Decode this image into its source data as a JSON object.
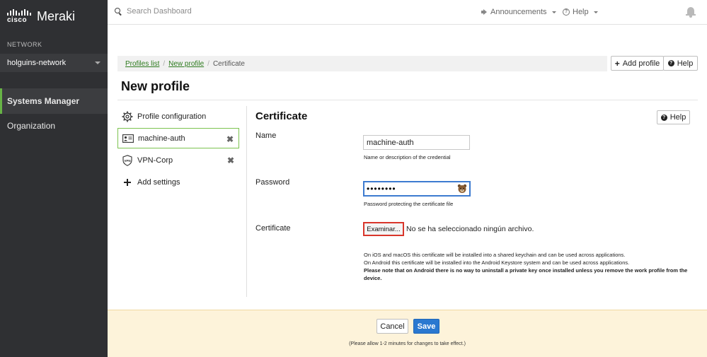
{
  "brand": {
    "cisco": "cisco",
    "meraki": "Meraki"
  },
  "sidebar": {
    "network_caption": "NETWORK",
    "network_name": "holguins-network",
    "items": [
      {
        "label": "Systems Manager",
        "active": true
      },
      {
        "label": "Organization",
        "active": false
      }
    ]
  },
  "topbar": {
    "search_placeholder": "Search Dashboard",
    "announcements": "Announcements",
    "help": "Help"
  },
  "breadcrumb": {
    "items": [
      {
        "label": "Profiles list",
        "link": true
      },
      {
        "label": "New profile",
        "link": true
      },
      {
        "label": "Certificate",
        "link": false
      }
    ]
  },
  "actions": {
    "add_profile": "Add profile",
    "help": "Help"
  },
  "page": {
    "title": "New profile"
  },
  "payloads": [
    {
      "label": "Profile configuration",
      "icon": "gear-icon"
    },
    {
      "label": "machine-auth",
      "icon": "id-card-icon",
      "selected": true,
      "removable": true
    },
    {
      "label": "VPN-Corp",
      "icon": "vpn-shield-icon",
      "removable": true
    },
    {
      "label": "Add settings",
      "icon": "plus-icon"
    }
  ],
  "remove_glyph": "✖",
  "form": {
    "section_title": "Certificate",
    "help": "Help",
    "name_label": "Name",
    "name_value": "machine-auth",
    "name_help": "Name or description of the credential",
    "password_label": "Password",
    "password_value": "••••••••",
    "password_help": "Password protecting the certificate file",
    "cert_label": "Certificate",
    "file_button": "Examinar...",
    "file_status": "No se ha seleccionado ningún archivo.",
    "notes": [
      "On iOS and macOS this certificate will be installed into a shared keychain and can be used across applications.",
      "On Android this certificate will be installed into the Android Keystore system and can be used across applications."
    ],
    "notes_bold": "Please note that on Android there is no way to uninstall a private key once installed unless you remove the work profile from the device."
  },
  "footer": {
    "cancel": "Cancel",
    "save": "Save",
    "note": "(Please allow 1-2 minutes for changes to take effect.)"
  },
  "colors": {
    "accent_green": "#67b346",
    "save_blue": "#2a78d0",
    "highlight_red": "#d9362b",
    "savebar_bg": "#fdf3da"
  }
}
